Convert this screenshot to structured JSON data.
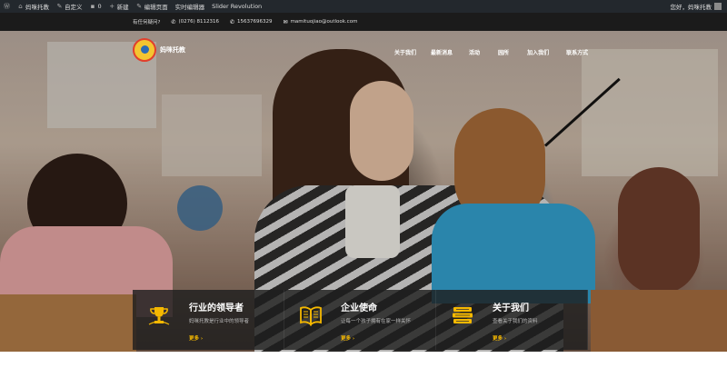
{
  "adminbar": {
    "items": [
      {
        "icon": "wordpress-icon",
        "label": ""
      },
      {
        "icon": "home-icon",
        "label": "妈咪托教"
      },
      {
        "icon": "brush-icon",
        "label": "自定义"
      },
      {
        "icon": "comment-icon",
        "label": "0"
      },
      {
        "icon": "plus-icon",
        "label": "新建"
      },
      {
        "icon": "pencil-icon",
        "label": "编辑页面"
      },
      {
        "icon": "",
        "label": "实时编辑器"
      },
      {
        "icon": "",
        "label": "Slider Revolution"
      }
    ],
    "greeting": "您好，妈咪托教"
  },
  "topbar": {
    "question": "有任何疑问?",
    "phone": "(0276) 8112316",
    "mobile": "15637696329",
    "email": "mamituojiao@outlook.com"
  },
  "header": {
    "logo_text": "妈咪托教",
    "nav": [
      "关于我们",
      "最新消息",
      "活动",
      "园所",
      "加入我们",
      "联系方式"
    ]
  },
  "features": [
    {
      "icon": "trophy-icon",
      "title": "行业的领导者",
      "desc": "妈咪托教是行业中的领导者",
      "more": "更多 ›"
    },
    {
      "icon": "book-icon",
      "title": "企业使命",
      "desc": "让每一个孩子拥有在家一样关怀",
      "more": "更多 ›"
    },
    {
      "icon": "books-stack-icon",
      "title": "关于我们",
      "desc": "查看关于我们的资料",
      "more": "更多 ›"
    }
  ],
  "colors": {
    "accent": "#f5b800",
    "adminbar": "#23282d"
  }
}
